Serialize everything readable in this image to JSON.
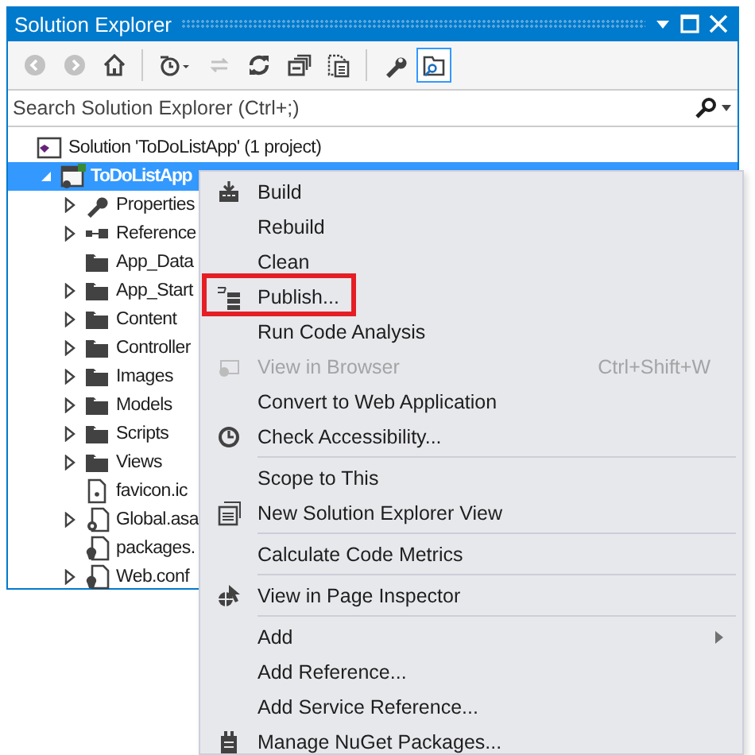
{
  "window": {
    "title": "Solution Explorer"
  },
  "toolbar": [
    {
      "kind": "back",
      "disabled": true,
      "selected": false
    },
    {
      "kind": "forward",
      "disabled": true,
      "selected": false
    },
    {
      "kind": "home",
      "disabled": false,
      "selected": false
    },
    {
      "kind": "separator"
    },
    {
      "kind": "history",
      "disabled": false,
      "selected": false
    },
    {
      "kind": "sync",
      "disabled": true,
      "selected": false
    },
    {
      "kind": "refresh",
      "disabled": false,
      "selected": false
    },
    {
      "kind": "collapse",
      "disabled": false,
      "selected": false
    },
    {
      "kind": "show-all",
      "disabled": false,
      "selected": false
    },
    {
      "kind": "separator"
    },
    {
      "kind": "properties",
      "disabled": false,
      "selected": false
    },
    {
      "kind": "preview",
      "disabled": false,
      "selected": true
    }
  ],
  "search": {
    "placeholder": "Search Solution Explorer (Ctrl+;)"
  },
  "tree": [
    {
      "label": "Solution 'ToDoListApp' (1 project)",
      "kind": "solution",
      "selected": false,
      "children": [
        {
          "label": "ToDoListApp",
          "kind": "project",
          "selected": true,
          "expanded": true,
          "children": [
            {
              "label": "Properties",
              "kind": "properties",
              "selected": false,
              "expanded": false
            },
            {
              "label": "Reference",
              "kind": "references",
              "selected": false,
              "expanded": false
            },
            {
              "label": "App_Data",
              "kind": "folder",
              "selected": false
            },
            {
              "label": "App_Start",
              "kind": "folder",
              "selected": false,
              "expanded": false
            },
            {
              "label": "Content",
              "kind": "folder",
              "selected": false,
              "expanded": false
            },
            {
              "label": "Controller",
              "kind": "folder",
              "selected": false,
              "expanded": false
            },
            {
              "label": "Images",
              "kind": "folder",
              "selected": false,
              "expanded": false
            },
            {
              "label": "Models",
              "kind": "folder",
              "selected": false,
              "expanded": false
            },
            {
              "label": "Scripts",
              "kind": "folder",
              "selected": false,
              "expanded": false
            },
            {
              "label": "Views",
              "kind": "folder",
              "selected": false,
              "expanded": false
            },
            {
              "label": "favicon.ic",
              "kind": "file",
              "selected": false
            },
            {
              "label": "Global.asa",
              "kind": "code-file",
              "selected": false,
              "expanded": false
            },
            {
              "label": "packages.",
              "kind": "config",
              "selected": false
            },
            {
              "label": "Web.conf",
              "kind": "config",
              "selected": false,
              "expanded": false
            }
          ]
        }
      ]
    }
  ],
  "context_menu": {
    "items": [
      {
        "kind": "item",
        "label": "Build",
        "disabled": false
      },
      {
        "kind": "item",
        "label": "Rebuild",
        "disabled": false
      },
      {
        "kind": "item",
        "label": "Clean",
        "disabled": false
      },
      {
        "kind": "item",
        "label": "Publish...",
        "disabled": false,
        "highlighted": true
      },
      {
        "kind": "item",
        "label": "Run Code Analysis",
        "disabled": false
      },
      {
        "kind": "item",
        "label": "View in Browser",
        "shortcut": "Ctrl+Shift+W",
        "disabled": true
      },
      {
        "kind": "item",
        "label": "Convert to Web Application",
        "disabled": false
      },
      {
        "kind": "item",
        "label": "Check Accessibility...",
        "disabled": false
      },
      {
        "kind": "separator"
      },
      {
        "kind": "item",
        "label": "Scope to This",
        "disabled": false
      },
      {
        "kind": "item",
        "label": "New Solution Explorer View",
        "disabled": false
      },
      {
        "kind": "separator"
      },
      {
        "kind": "item",
        "label": "Calculate Code Metrics",
        "disabled": false
      },
      {
        "kind": "separator"
      },
      {
        "kind": "item",
        "label": "View in Page Inspector",
        "disabled": false
      },
      {
        "kind": "separator"
      },
      {
        "kind": "item",
        "label": "Add",
        "disabled": false,
        "submenu": true
      },
      {
        "kind": "item",
        "label": "Add Reference...",
        "disabled": false
      },
      {
        "kind": "item",
        "label": "Add Service Reference...",
        "disabled": false
      },
      {
        "kind": "item",
        "label": "Manage NuGet Packages...",
        "disabled": false
      }
    ]
  }
}
